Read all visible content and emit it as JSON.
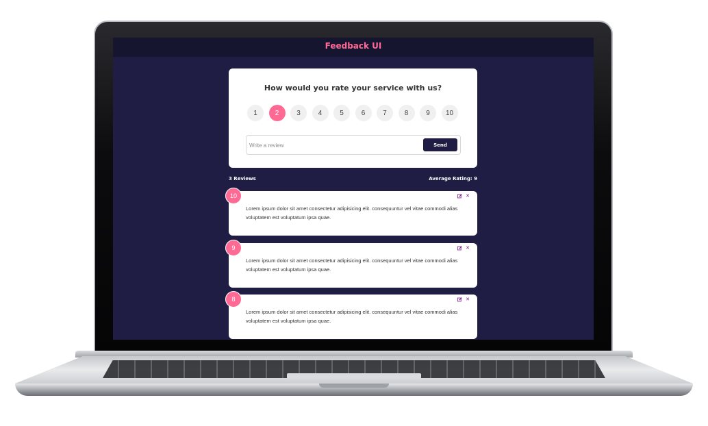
{
  "app": {
    "title": "Feedback UI"
  },
  "rating": {
    "question": "How would you rate your service with us?",
    "options": [
      "1",
      "2",
      "3",
      "4",
      "5",
      "6",
      "7",
      "8",
      "9",
      "10"
    ],
    "selected": "2"
  },
  "form": {
    "placeholder": "Write a review",
    "send_label": "Send"
  },
  "stats": {
    "count_label": "3 Reviews",
    "average_label": "Average Rating: 9"
  },
  "reviews": [
    {
      "rating": "10",
      "text": "Lorem ipsum dolor sit amet consectetur adipisicing elit. consequuntur vel vitae commodi alias voluptatem est voluptatum ipsa quae."
    },
    {
      "rating": "9",
      "text": "Lorem ipsum dolor sit amet consectetur adipisicing elit. consequuntur vel vitae commodi alias voluptatem est voluptatum ipsa quae."
    },
    {
      "rating": "8",
      "text": "Lorem ipsum dolor sit amet consectetur adipisicing elit. consequuntur vel vitae commodi alias voluptatem est voluptatum ipsa quae."
    }
  ],
  "icons": {
    "edit": "edit-icon",
    "close": "close-icon"
  },
  "colors": {
    "accent": "#ff6a95",
    "background": "#1f1d44",
    "header": "#161530",
    "action": "#7b1a8b"
  }
}
